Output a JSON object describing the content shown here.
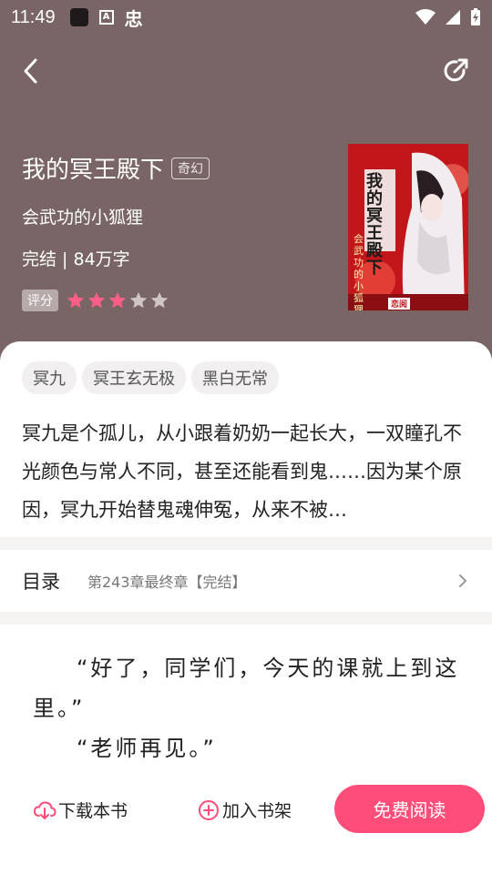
{
  "status_bar": {
    "time": "11:49",
    "ghost_char": "忠"
  },
  "book": {
    "title": "我的冥王殿下",
    "genre": "奇幻",
    "author": "会武功的小狐狸",
    "status_words": "完结 | 84万字",
    "rating_label": "评分",
    "rating_stars": 3,
    "rating_max": 5,
    "cover": {
      "title": "我的冥王殿下",
      "author": "会武功的小狐狸",
      "badge": "恋阅"
    }
  },
  "tags": [
    "冥九",
    "冥王玄无极",
    "黑白无常"
  ],
  "synopsis": "冥九是个孤儿，从小跟着奶奶一起长大，一双瞳孔不光颜色与常人不同，甚至还能看到鬼……因为某个原因，冥九开始替鬼魂伸冤，从来不被…",
  "catalog": {
    "label": "目录",
    "latest": "第243章最终章【完结】"
  },
  "preview": {
    "lines": [
      "“好了，同学们，今天的课就上到这里。”",
      "“老师再见。”"
    ]
  },
  "actions": {
    "download": "下载本书",
    "add_shelf": "加入书架",
    "read_free": "免费阅读"
  },
  "colors": {
    "header_bg": "#7a6566",
    "accent": "#ff4d7a",
    "star_on": "#ff5f86",
    "star_off": "#cfc5c6"
  }
}
